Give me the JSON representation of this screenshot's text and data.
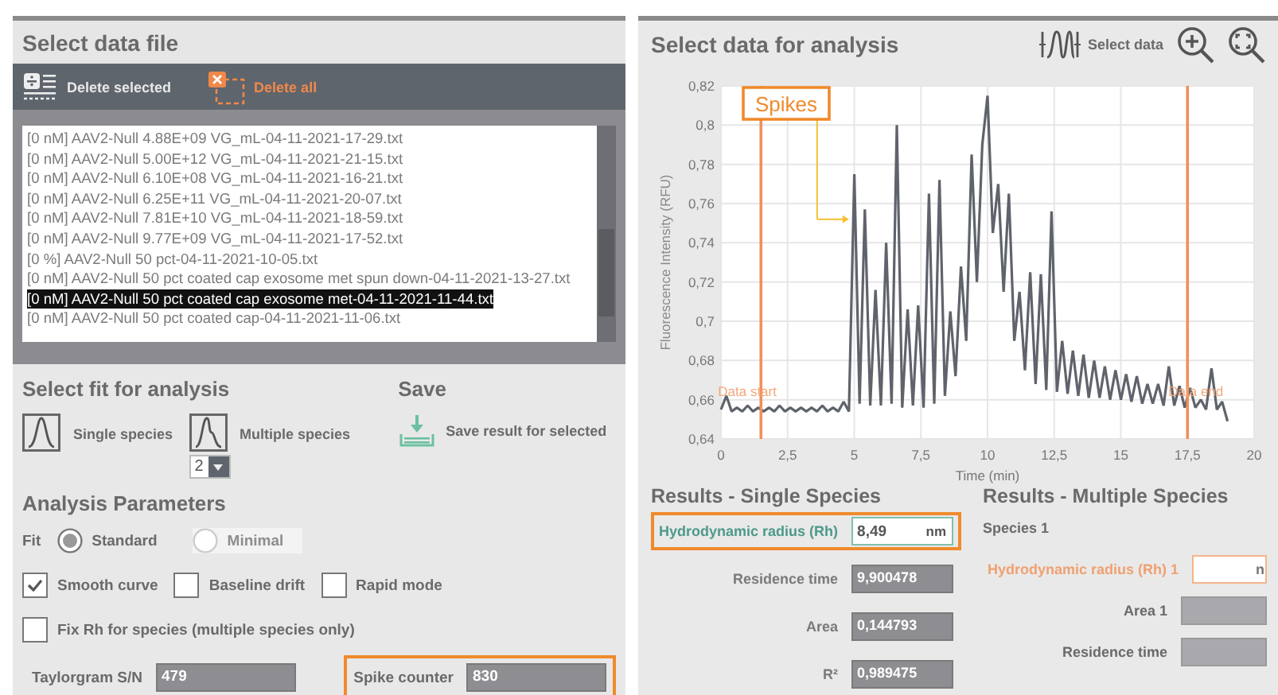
{
  "file_panel": {
    "title": "Select data file",
    "toolbar": [
      {
        "kind": "delete_selected",
        "label": "Delete selected"
      },
      {
        "kind": "delete_all",
        "label": "Delete all"
      }
    ],
    "files": [
      {
        "name": "[0 nM] AAV2-Null 4.88E+09 VG_mL-04-11-2021-17-29.txt",
        "selected": false
      },
      {
        "name": "[0 nM] AAV2-Null 5.00E+12 VG_mL-04-11-2021-21-15.txt",
        "selected": false
      },
      {
        "name": "[0 nM] AAV2-Null 6.10E+08 VG_mL-04-11-2021-16-21.txt",
        "selected": false
      },
      {
        "name": "[0 nM] AAV2-Null 6.25E+11 VG_mL-04-11-2021-20-07.txt",
        "selected": false
      },
      {
        "name": "[0 nM] AAV2-Null 7.81E+10 VG_mL-04-11-2021-18-59.txt",
        "selected": false
      },
      {
        "name": "[0 nM] AAV2-Null 9.77E+09 VG_mL-04-11-2021-17-52.txt",
        "selected": false
      },
      {
        "name": "[0 %] AAV2-Null 50 pct-04-11-2021-10-05.txt",
        "selected": false
      },
      {
        "name": "[0 nM] AAV2-Null 50 pct coated cap exosome met spun down-04-11-2021-13-27.txt",
        "selected": false
      },
      {
        "name": "[0 nM] AAV2-Null 50 pct coated cap exosome met-04-11-2021-11-44.txt",
        "selected": true
      },
      {
        "name": "[0 nM] AAV2-Null 50 pct coated cap-04-11-2021-11-06.txt",
        "selected": false
      }
    ]
  },
  "fit": {
    "title": "Select fit for analysis",
    "options": [
      {
        "kind": "single",
        "label": "Single species"
      },
      {
        "kind": "multiple",
        "label": "Multiple species"
      }
    ],
    "species_count": "2"
  },
  "save": {
    "title": "Save",
    "button": "Save result for selected"
  },
  "parameters": {
    "title": "Analysis Parameters",
    "fit_label": "Fit",
    "fit_modes": [
      {
        "label": "Standard",
        "selected": true,
        "disabled": false
      },
      {
        "label": "Minimal",
        "selected": false,
        "disabled": true
      }
    ],
    "options": [
      {
        "label": "Smooth curve",
        "checked": true
      },
      {
        "label": "Baseline drift",
        "checked": false
      },
      {
        "label": "Rapid mode",
        "checked": false
      }
    ],
    "fix_rh": {
      "label": "Fix Rh for species (multiple species only)",
      "checked": false
    },
    "fields": [
      {
        "label": "Taylorgram S/N",
        "value": "479",
        "highlighted": false
      },
      {
        "label": "Spike counter",
        "value": "830",
        "highlighted": true
      }
    ]
  },
  "analysis_panel": {
    "title": "Select data for analysis",
    "select_button": "Select data",
    "chart_data": {
      "type": "line",
      "xlabel": "Time (min)",
      "ylabel": "Fluorescence Intensity (RFU)",
      "xlim": [
        0,
        20
      ],
      "ylim": [
        0.64,
        0.82
      ],
      "xticks": [
        {
          "value": 0,
          "label": "0"
        },
        {
          "value": 2.5,
          "label": "2,5"
        },
        {
          "value": 5,
          "label": "5"
        },
        {
          "value": 7.5,
          "label": "7,5"
        },
        {
          "value": 10,
          "label": "10"
        },
        {
          "value": 12.5,
          "label": "12,5"
        },
        {
          "value": 15,
          "label": "15"
        },
        {
          "value": 17.5,
          "label": "17,5"
        },
        {
          "value": 20,
          "label": "20"
        }
      ],
      "yticks": [
        {
          "value": 0.64,
          "label": "0,64"
        },
        {
          "value": 0.66,
          "label": "0,66"
        },
        {
          "value": 0.68,
          "label": "0,68"
        },
        {
          "value": 0.7,
          "label": "0,7"
        },
        {
          "value": 0.72,
          "label": "0,72"
        },
        {
          "value": 0.74,
          "label": "0,74"
        },
        {
          "value": 0.76,
          "label": "0,76"
        },
        {
          "value": 0.78,
          "label": "0,78"
        },
        {
          "value": 0.8,
          "label": "0,8"
        },
        {
          "value": 0.82,
          "label": "0,82"
        }
      ],
      "x": [
        0,
        0.2,
        0.4,
        0.6,
        0.8,
        1,
        1.2,
        1.4,
        1.6,
        1.8,
        2,
        2.2,
        2.4,
        2.6,
        2.8,
        3,
        3.2,
        3.4,
        3.6,
        3.8,
        4,
        4.2,
        4.4,
        4.6,
        4.8,
        5,
        5.2,
        5.4,
        5.6,
        5.8,
        6,
        6.2,
        6.4,
        6.6,
        6.8,
        7,
        7.2,
        7.4,
        7.6,
        7.8,
        8,
        8.2,
        8.4,
        8.6,
        8.8,
        9,
        9.2,
        9.4,
        9.6,
        9.8,
        10,
        10.2,
        10.4,
        10.6,
        10.8,
        11,
        11.2,
        11.4,
        11.6,
        11.8,
        12,
        12.2,
        12.4,
        12.6,
        12.8,
        13,
        13.2,
        13.4,
        13.6,
        13.8,
        14,
        14.2,
        14.4,
        14.6,
        14.8,
        15,
        15.2,
        15.4,
        15.6,
        15.8,
        16,
        16.2,
        16.4,
        16.6,
        16.8,
        17,
        17.2,
        17.4,
        17.6,
        17.8,
        18,
        18.2,
        18.4,
        18.6,
        18.8,
        19
      ],
      "grid": true,
      "series": [
        {
          "color": "#5f636b",
          "values": [
            0.655,
            0.662,
            0.654,
            0.656,
            0.654,
            0.657,
            0.654,
            0.656,
            0.654,
            0.656,
            0.654,
            0.657,
            0.654,
            0.656,
            0.654,
            0.656,
            0.654,
            0.656,
            0.654,
            0.657,
            0.654,
            0.656,
            0.654,
            0.659,
            0.654,
            0.775,
            0.658,
            0.757,
            0.657,
            0.716,
            0.657,
            0.74,
            0.658,
            0.8,
            0.656,
            0.706,
            0.657,
            0.708,
            0.656,
            0.765,
            0.658,
            0.772,
            0.662,
            0.705,
            0.672,
            0.728,
            0.69,
            0.785,
            0.72,
            0.79,
            0.815,
            0.745,
            0.77,
            0.715,
            0.765,
            0.69,
            0.715,
            0.675,
            0.725,
            0.668,
            0.724,
            0.665,
            0.756,
            0.664,
            0.69,
            0.663,
            0.685,
            0.662,
            0.683,
            0.661,
            0.68,
            0.661,
            0.677,
            0.66,
            0.675,
            0.66,
            0.673,
            0.659,
            0.672,
            0.658,
            0.668,
            0.658,
            0.668,
            0.657,
            0.677,
            0.657,
            0.667,
            0.656,
            0.666,
            0.656,
            0.66,
            0.655,
            0.676,
            0.655,
            0.659,
            0.649
          ]
        }
      ],
      "ref_lines": [
        {
          "axis": "x",
          "value": 1.5,
          "label": "Data start"
        },
        {
          "axis": "x",
          "value": 17.5,
          "label": "Data end"
        }
      ],
      "annotations": [
        "Spikes"
      ]
    }
  },
  "results_single": {
    "title": "Results - Single Species",
    "fields": [
      {
        "label": "Hydrodynamic radius (Rh)",
        "value": "8,49",
        "unit": "nm",
        "highlighted": true,
        "editable": true
      },
      {
        "label": "Residence time",
        "value": "9,900478",
        "highlighted": false,
        "editable": false
      },
      {
        "label": "Area",
        "value": "0,144793",
        "highlighted": false,
        "editable": false
      },
      {
        "label": "R²",
        "value": "0,989475",
        "highlighted": false,
        "editable": false
      }
    ]
  },
  "results_multiple": {
    "title": "Results - Multiple Species",
    "species": "Species 1",
    "fields": [
      {
        "label": "Hydrodynamic radius (Rh) 1",
        "unit": "n",
        "editable": true
      },
      {
        "label": "Area 1",
        "editable": false
      },
      {
        "label": "Residence time",
        "editable": false
      }
    ]
  }
}
